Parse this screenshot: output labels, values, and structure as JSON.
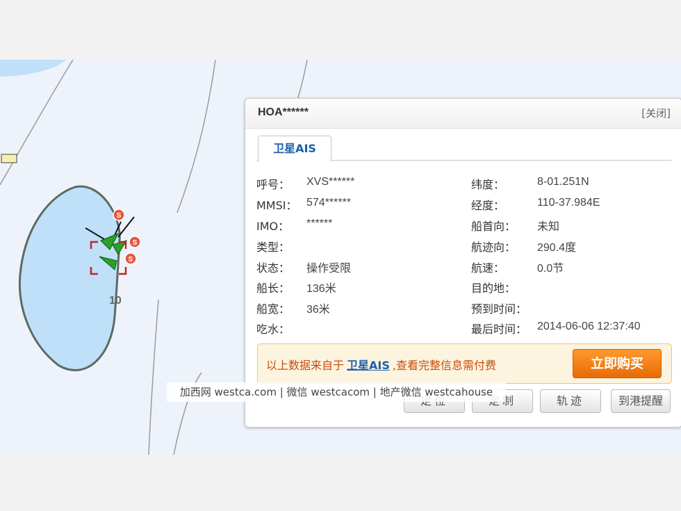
{
  "map": {
    "depth_label": "10",
    "ship_badge": "S",
    "colors": {
      "water": "#bfe0f8",
      "land": "#eef3fb",
      "ship": "#2aa02a",
      "target": "#c42323"
    }
  },
  "popup": {
    "vessel_name": "HOA******",
    "close_label": "[关闭]",
    "tab_label": "卫星AIS",
    "left_rows": [
      {
        "label": "呼号：",
        "value": "XVS******"
      },
      {
        "label": "MMSI：",
        "value": "574******"
      },
      {
        "label": "IMO：",
        "value": "******"
      },
      {
        "label": "类型：",
        "value": ""
      },
      {
        "label": "状态：",
        "value": "操作受限"
      },
      {
        "label": "船长：",
        "value": "136米"
      },
      {
        "label": "船宽：",
        "value": "36米"
      },
      {
        "label": "吃水：",
        "value": ""
      }
    ],
    "right_rows": [
      {
        "label": "纬度：",
        "value": "8-01.251N"
      },
      {
        "label": "经度：",
        "value": "110-37.984E"
      },
      {
        "label": "船首向：",
        "value": "未知"
      },
      {
        "label": "航迹向：",
        "value": "290.4度"
      },
      {
        "label": "航速：",
        "value": "0.0节"
      },
      {
        "label": "目的地：",
        "value": ""
      },
      {
        "label": "预到时间：",
        "value": ""
      },
      {
        "label": "最后时间：",
        "value": "2014-06-06 12:37:40"
      }
    ],
    "notice": {
      "prefix": "以上数据来自于",
      "link": "卫星AIS",
      "suffix": ",查看完整信息需付费",
      "buy_label": "立即购买"
    },
    "buttons": [
      "定位",
      "定制",
      "轨迹",
      "到港提醒"
    ]
  },
  "watermark": "加西网 westca.com | 微信 westcacom | 地产微信 westcahouse"
}
